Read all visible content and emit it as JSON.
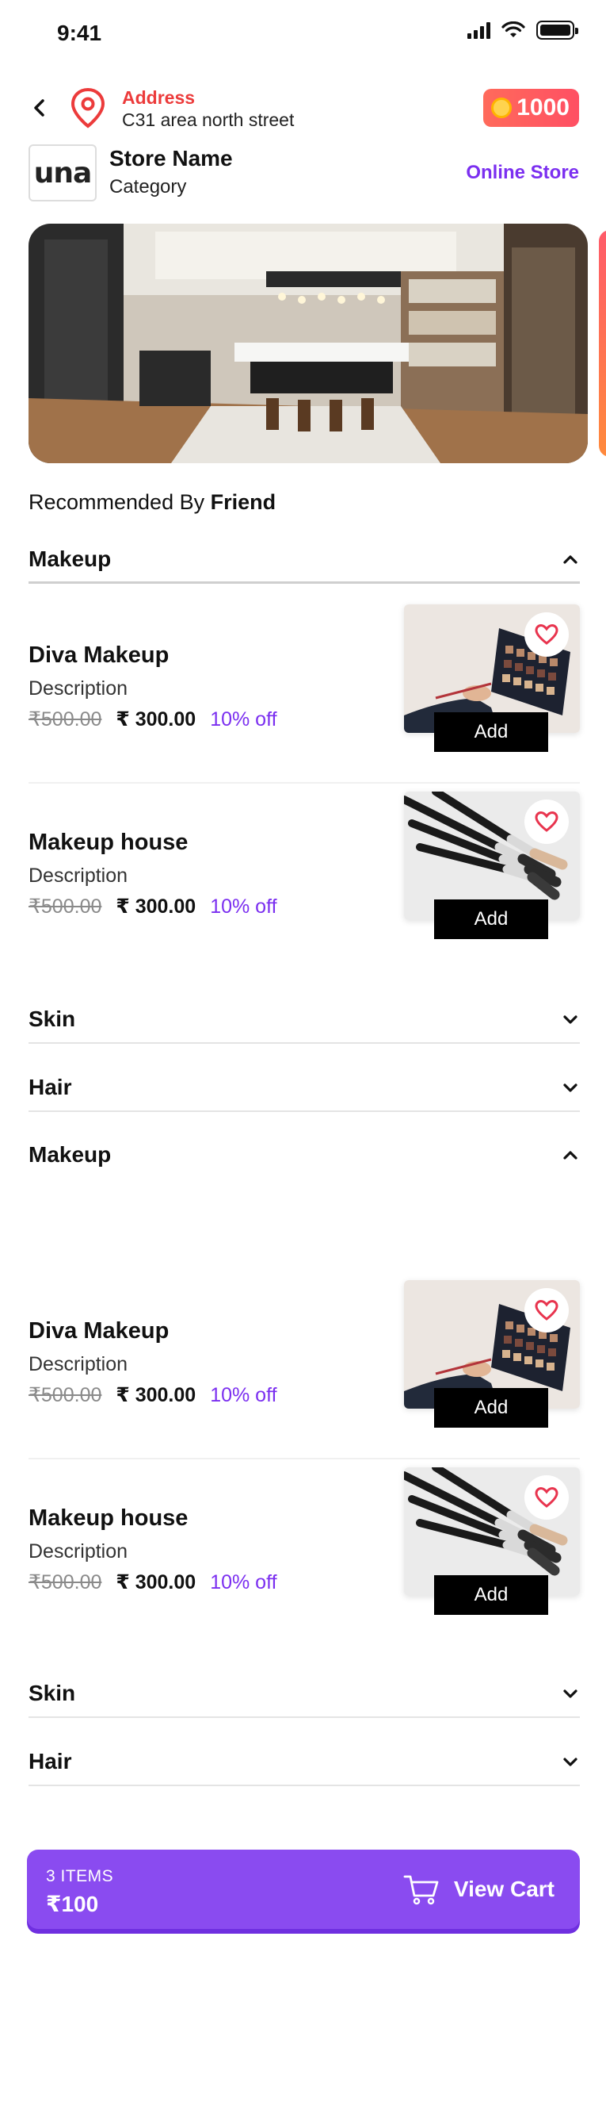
{
  "status": {
    "time": "9:41"
  },
  "header": {
    "address_label": "Address",
    "address_value": "C31 area north street",
    "coins": "1000"
  },
  "store": {
    "logo_text": "una",
    "name": "Store Name",
    "category": "Category",
    "online_store": "Online Store"
  },
  "recommended": {
    "prefix": "Recommended By",
    "who": "Friend"
  },
  "categories": [
    {
      "title": "Makeup",
      "open": true
    },
    {
      "title": "Skin",
      "open": false
    },
    {
      "title": "Hair",
      "open": false
    },
    {
      "title": "Makeup",
      "open": true
    },
    {
      "title": "Skin",
      "open": false
    },
    {
      "title": "Hair",
      "open": false
    }
  ],
  "products": [
    {
      "name": "Diva Makeup",
      "description": "Description",
      "old_price": "₹500.00",
      "price": "₹ 300.00",
      "discount": "10% off",
      "add_label": "Add",
      "image": "eyeshadow-palette"
    },
    {
      "name": "Makeup house",
      "description": "Description",
      "old_price": "₹500.00",
      "price": "₹ 300.00",
      "discount": "10% off",
      "add_label": "Add",
      "image": "makeup-brushes"
    },
    {
      "name": "Diva Makeup",
      "description": "Description",
      "old_price": "₹500.00",
      "price": "₹ 300.00",
      "discount": "10% off",
      "add_label": "Add",
      "image": "eyeshadow-palette"
    },
    {
      "name": "Makeup house",
      "description": "Description",
      "old_price": "₹500.00",
      "price": "₹ 300.00",
      "discount": "10% off",
      "add_label": "Add",
      "image": "makeup-brushes"
    }
  ],
  "cart": {
    "count": "3 ITEMS",
    "total": "₹100",
    "view_label": "View Cart"
  },
  "colors": {
    "accent": "#7b2ff0",
    "address_red": "#ec3b3b",
    "cart_bar": "#8a4bf0",
    "coin_badge": "#ff5b60",
    "heart": "#e8344e"
  }
}
